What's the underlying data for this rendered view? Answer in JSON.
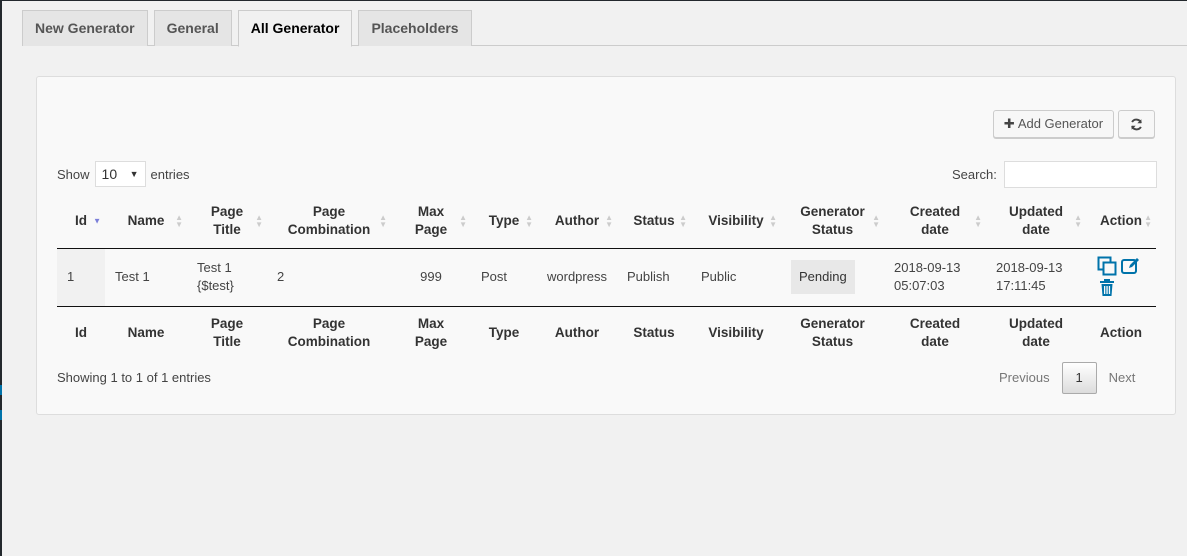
{
  "tabs": [
    {
      "label": "New Generator",
      "active": false
    },
    {
      "label": "General",
      "active": false
    },
    {
      "label": "All Generator",
      "active": true
    },
    {
      "label": "Placeholders",
      "active": false
    }
  ],
  "toolbar": {
    "add_label": "Add Generator",
    "add_icon": "plus-icon",
    "refresh_icon": "refresh-icon"
  },
  "length": {
    "show_label": "Show",
    "value": "10",
    "entries_label": "entries"
  },
  "search": {
    "label": "Search:",
    "value": ""
  },
  "table": {
    "columns": [
      "Id",
      "Name",
      "Page Title",
      "Page Combination",
      "Max Page",
      "Type",
      "Author",
      "Status",
      "Visibility",
      "Generator Status",
      "Created date",
      "Updated date",
      "Action"
    ],
    "columns_split": [
      [
        "Id",
        ""
      ],
      [
        "Name",
        ""
      ],
      [
        "Page",
        "Title"
      ],
      [
        "Page",
        "Combination"
      ],
      [
        "Max",
        "Page"
      ],
      [
        "Type",
        ""
      ],
      [
        "Author",
        ""
      ],
      [
        "Status",
        ""
      ],
      [
        "Visibility",
        ""
      ],
      [
        "Generator",
        "Status"
      ],
      [
        "Created",
        "date"
      ],
      [
        "Updated",
        "date"
      ],
      [
        "Action",
        ""
      ]
    ],
    "sorted_column": "Id",
    "sort_direction": "ascending",
    "rows": [
      {
        "id": "1",
        "name": "Test 1",
        "page_title_line1": "Test 1",
        "page_title_line2": "{$test}",
        "page_combination": "2",
        "max_page": "999",
        "type": "Post",
        "author": "wordpress",
        "status": "Publish",
        "visibility": "Public",
        "generator_status": "Pending",
        "created_date": "2018-09-13",
        "created_time": "05:07:03",
        "updated_date": "2018-09-13",
        "updated_time": "17:11:45",
        "actions": [
          "copy-icon",
          "edit-icon",
          "trash-icon"
        ]
      }
    ]
  },
  "footer": {
    "info": "Showing 1 to 1 of 1 entries",
    "previous": "Previous",
    "current_page": "1",
    "next": "Next"
  },
  "colors": {
    "accent": "#0073aa",
    "sort_active": "#7b7fd9"
  }
}
